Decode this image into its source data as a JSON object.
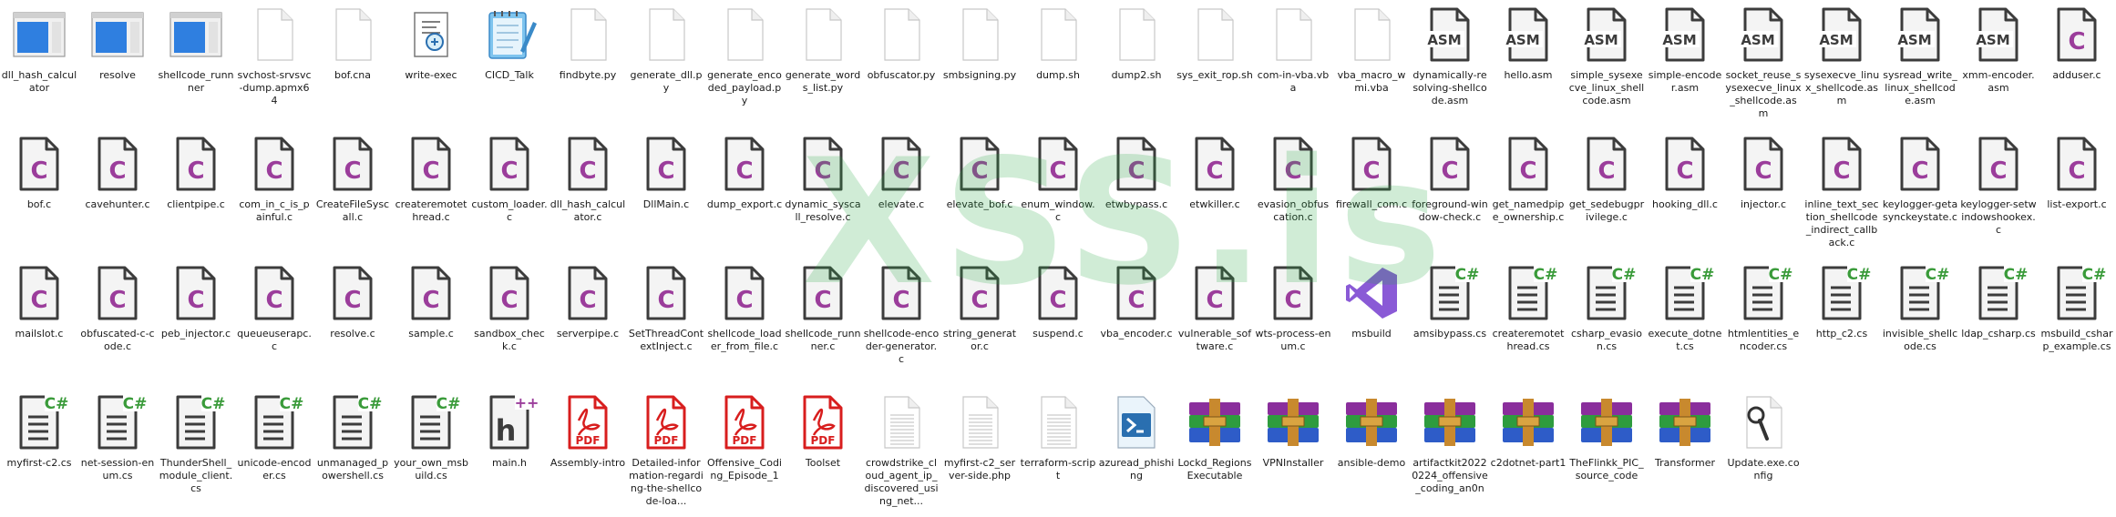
{
  "watermark": "XSS.is",
  "colors": {
    "c_letter": "#9b3d9b",
    "cs_badge": "#3a9b3a",
    "pdf_red": "#d81e1e",
    "vs_purple": "#8a5ad6",
    "exe_blue": "#2f7fe0"
  },
  "files": [
    {
      "name": "dll_hash_calculator",
      "icon": "exe-window-icon"
    },
    {
      "name": "resolve",
      "icon": "exe-window-icon"
    },
    {
      "name": "shellcode_runnner",
      "icon": "exe-window-icon"
    },
    {
      "name": "svchost-srvsvc-dump.apmx64",
      "icon": "blank-file-icon"
    },
    {
      "name": "bof.cna",
      "icon": "blank-file-icon"
    },
    {
      "name": "write-exec",
      "icon": "script-file-icon"
    },
    {
      "name": "CICD_Talk",
      "icon": "notepad-icon"
    },
    {
      "name": "findbyte.py",
      "icon": "blank-file-icon"
    },
    {
      "name": "generate_dll.py",
      "icon": "blank-file-icon"
    },
    {
      "name": "generate_encoded_payload.py",
      "icon": "blank-file-icon"
    },
    {
      "name": "generate_words_list.py",
      "icon": "blank-file-icon"
    },
    {
      "name": "obfuscator.py",
      "icon": "blank-file-icon"
    },
    {
      "name": "smbsigning.py",
      "icon": "blank-file-icon"
    },
    {
      "name": "dump.sh",
      "icon": "blank-file-icon"
    },
    {
      "name": "dump2.sh",
      "icon": "blank-file-icon"
    },
    {
      "name": "sys_exit_rop.sh",
      "icon": "blank-file-icon"
    },
    {
      "name": "com-in-vba.vba",
      "icon": "blank-file-icon"
    },
    {
      "name": "vba_macro_wmi.vba",
      "icon": "blank-file-icon"
    },
    {
      "name": "dynamically-resolving-shellcode.asm",
      "icon": "asm-file-icon"
    },
    {
      "name": "hello.asm",
      "icon": "asm-file-icon"
    },
    {
      "name": "simple_sysexecve_linux_shellcode.asm",
      "icon": "asm-file-icon"
    },
    {
      "name": "simple-encoder.asm",
      "icon": "asm-file-icon"
    },
    {
      "name": "socket_reuse_sysexecve_linux_shellcode.asm",
      "icon": "asm-file-icon"
    },
    {
      "name": "sysexecve_linux_shellcode.asm",
      "icon": "asm-file-icon"
    },
    {
      "name": "sysread_write_linux_shellcode.asm",
      "icon": "asm-file-icon"
    },
    {
      "name": "xmm-encoder.asm",
      "icon": "asm-file-icon"
    },
    {
      "name": "adduser.c",
      "icon": "c-file-icon"
    },
    {
      "name": "bof.c",
      "icon": "c-file-icon"
    },
    {
      "name": "cavehunter.c",
      "icon": "c-file-icon"
    },
    {
      "name": "clientpipe.c",
      "icon": "c-file-icon"
    },
    {
      "name": "com_in_c_is_painful.c",
      "icon": "c-file-icon"
    },
    {
      "name": "CreateFileSyscall.c",
      "icon": "c-file-icon"
    },
    {
      "name": "createremotethread.c",
      "icon": "c-file-icon"
    },
    {
      "name": "custom_loader.c",
      "icon": "c-file-icon"
    },
    {
      "name": "dll_hash_calculator.c",
      "icon": "c-file-icon"
    },
    {
      "name": "DllMain.c",
      "icon": "c-file-icon"
    },
    {
      "name": "dump_export.c",
      "icon": "c-file-icon"
    },
    {
      "name": "dynamic_syscall_resolve.c",
      "icon": "c-file-icon"
    },
    {
      "name": "elevate.c",
      "icon": "c-file-icon"
    },
    {
      "name": "elevate_bof.c",
      "icon": "c-file-icon"
    },
    {
      "name": "enum_window.c",
      "icon": "c-file-icon"
    },
    {
      "name": "etwbypass.c",
      "icon": "c-file-icon"
    },
    {
      "name": "etwkiller.c",
      "icon": "c-file-icon"
    },
    {
      "name": "evasion_obfuscation.c",
      "icon": "c-file-icon"
    },
    {
      "name": "firewall_com.c",
      "icon": "c-file-icon"
    },
    {
      "name": "foreground-window-check.c",
      "icon": "c-file-icon"
    },
    {
      "name": "get_namedpipe_ownership.c",
      "icon": "c-file-icon"
    },
    {
      "name": "get_sedebugprivilege.c",
      "icon": "c-file-icon"
    },
    {
      "name": "hooking_dll.c",
      "icon": "c-file-icon"
    },
    {
      "name": "injector.c",
      "icon": "c-file-icon"
    },
    {
      "name": "inline_text_section_shellcode_indirect_callback.c",
      "icon": "c-file-icon"
    },
    {
      "name": "keylogger-getasynckeystate.c",
      "icon": "c-file-icon"
    },
    {
      "name": "keylogger-setwindowshookex.c",
      "icon": "c-file-icon"
    },
    {
      "name": "list-export.c",
      "icon": "c-file-icon"
    },
    {
      "name": "mailslot.c",
      "icon": "c-file-icon"
    },
    {
      "name": "obfuscated-c-code.c",
      "icon": "c-file-icon"
    },
    {
      "name": "peb_injector.c",
      "icon": "c-file-icon"
    },
    {
      "name": "queueuserapc.c",
      "icon": "c-file-icon"
    },
    {
      "name": "resolve.c",
      "icon": "c-file-icon"
    },
    {
      "name": "sample.c",
      "icon": "c-file-icon"
    },
    {
      "name": "sandbox_check.c",
      "icon": "c-file-icon"
    },
    {
      "name": "serverpipe.c",
      "icon": "c-file-icon"
    },
    {
      "name": "SetThreadContextInject.c",
      "icon": "c-file-icon"
    },
    {
      "name": "shellcode_loader_from_file.c",
      "icon": "c-file-icon"
    },
    {
      "name": "shellcode_runnner.c",
      "icon": "c-file-icon"
    },
    {
      "name": "shellcode-encoder-generator.c",
      "icon": "c-file-icon"
    },
    {
      "name": "string_generator.c",
      "icon": "c-file-icon"
    },
    {
      "name": "suspend.c",
      "icon": "c-file-icon"
    },
    {
      "name": "vba_encoder.c",
      "icon": "c-file-icon"
    },
    {
      "name": "vulnerable_software.c",
      "icon": "c-file-icon"
    },
    {
      "name": "wts-process-enum.c",
      "icon": "c-file-icon"
    },
    {
      "name": "msbuild",
      "icon": "visual-studio-icon"
    },
    {
      "name": "amsibypass.cs",
      "icon": "cs-file-icon"
    },
    {
      "name": "createremotethread.cs",
      "icon": "cs-file-icon"
    },
    {
      "name": "csharp_evasion.cs",
      "icon": "cs-file-icon"
    },
    {
      "name": "execute_dotnet.cs",
      "icon": "cs-file-icon"
    },
    {
      "name": "htmlentities_encoder.cs",
      "icon": "cs-file-icon"
    },
    {
      "name": "http_c2.cs",
      "icon": "cs-file-icon"
    },
    {
      "name": "invisible_shellcode.cs",
      "icon": "cs-file-icon"
    },
    {
      "name": "ldap_csharp.cs",
      "icon": "cs-file-icon"
    },
    {
      "name": "msbuild_csharp_example.cs",
      "icon": "cs-file-icon"
    },
    {
      "name": "myfirst-c2.cs",
      "icon": "cs-file-icon"
    },
    {
      "name": "net-session-enum.cs",
      "icon": "cs-file-icon"
    },
    {
      "name": "ThunderShell_module_client.cs",
      "icon": "cs-file-icon"
    },
    {
      "name": "unicode-encoder.cs",
      "icon": "cs-file-icon"
    },
    {
      "name": "unmanaged_powershell.cs",
      "icon": "cs-file-icon"
    },
    {
      "name": "your_own_msbuild.cs",
      "icon": "cs-file-icon"
    },
    {
      "name": "main.h",
      "icon": "h-file-icon"
    },
    {
      "name": "Assembly-intro",
      "icon": "pdf-file-icon"
    },
    {
      "name": "Detailed-information-regarding-the-shellcode-loa...",
      "icon": "pdf-file-icon"
    },
    {
      "name": "Offensive_Coding_Episode_1",
      "icon": "pdf-file-icon"
    },
    {
      "name": "Toolset",
      "icon": "pdf-file-icon"
    },
    {
      "name": "crowdstrike_cloud_agent_ip_discovered_using_net...",
      "icon": "text-file-icon"
    },
    {
      "name": "myfirst-c2_server-side.php",
      "icon": "text-file-icon"
    },
    {
      "name": "terraform-script",
      "icon": "text-file-icon"
    },
    {
      "name": "azuread_phishing",
      "icon": "powershell-file-icon"
    },
    {
      "name": "Lockd_RegionsExecutable",
      "icon": "rar-archive-icon"
    },
    {
      "name": "VPNInstaller",
      "icon": "rar-archive-icon"
    },
    {
      "name": "ansible-demo",
      "icon": "rar-archive-icon"
    },
    {
      "name": "artifactkit20220224_offensive_coding_an0n",
      "icon": "rar-archive-icon"
    },
    {
      "name": "c2dotnet-part1",
      "icon": "rar-archive-icon"
    },
    {
      "name": "TheFlinkk_PIC_source_code",
      "icon": "rar-archive-icon"
    },
    {
      "name": "Transformer",
      "icon": "rar-archive-icon"
    },
    {
      "name": "Update.exe.config",
      "icon": "config-file-icon"
    }
  ]
}
